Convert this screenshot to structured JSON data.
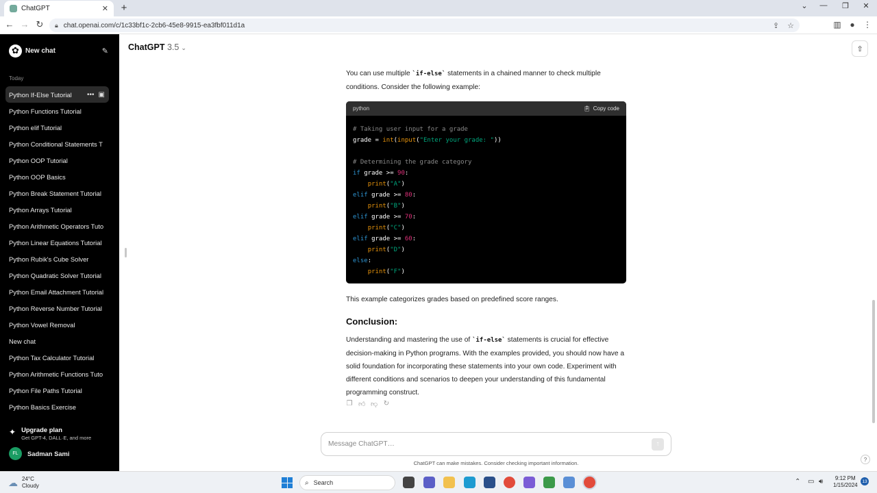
{
  "browser": {
    "tab_title": "ChatGPT",
    "tab_close": "✕",
    "new_tab": "+",
    "url": "chat.openai.com/c/1c33bf1c-2cb6-45e8-9915-ea3fbf011d1a"
  },
  "sidebar": {
    "new_chat_label": "New chat",
    "section_label": "Today",
    "items": [
      {
        "label": "Python If-Else Tutorial"
      },
      {
        "label": "Python Functions Tutorial"
      },
      {
        "label": "Python elif Tutorial"
      },
      {
        "label": "Python Conditional Statements T"
      },
      {
        "label": "Python OOP Tutorial"
      },
      {
        "label": "Python OOP Basics"
      },
      {
        "label": "Python Break Statement Tutorial"
      },
      {
        "label": "Python Arrays Tutorial"
      },
      {
        "label": "Python Arithmetic Operators Tuto"
      },
      {
        "label": "Python Linear Equations Tutorial"
      },
      {
        "label": "Python Rubik's Cube Solver"
      },
      {
        "label": "Python Quadratic Solver Tutorial"
      },
      {
        "label": "Python Email Attachment Tutorial"
      },
      {
        "label": "Python Reverse Number Tutorial"
      },
      {
        "label": "Python Vowel Removal"
      },
      {
        "label": "New chat"
      },
      {
        "label": "Python Tax Calculator Tutorial"
      },
      {
        "label": "Python Arithmetic Functions Tuto"
      },
      {
        "label": "Python File Paths Tutorial"
      },
      {
        "label": "Python Basics Exercise"
      }
    ],
    "upgrade_title": "Upgrade plan",
    "upgrade_subtitle": "Get GPT-4, DALL·E, and more",
    "user_initials": "FL",
    "user_name": "Sadman Sami"
  },
  "header": {
    "model_name": "ChatGPT",
    "model_version": "3.5"
  },
  "message": {
    "intro_before": "You can use multiple ",
    "intro_code": "`if-else`",
    "intro_after": " statements in a chained manner to check multiple conditions. Consider the following example:",
    "code_lang": "python",
    "copy_label": "Copy code",
    "code_lines": [
      [
        [
          "c-com",
          "# Taking user input for a grade"
        ]
      ],
      [
        [
          "",
          "grade = "
        ],
        [
          "c-fn",
          "int"
        ],
        [
          "",
          "("
        ],
        [
          "c-fn",
          "input"
        ],
        [
          "",
          "("
        ],
        [
          "c-str",
          "\"Enter your grade: \""
        ],
        [
          "",
          "))"
        ]
      ],
      [
        [
          "",
          ""
        ]
      ],
      [
        [
          "c-com",
          "# Determining the grade category"
        ]
      ],
      [
        [
          "c-kw",
          "if"
        ],
        [
          "",
          " grade >= "
        ],
        [
          "c-num",
          "90"
        ],
        [
          "",
          ":"
        ]
      ],
      [
        [
          "",
          "    "
        ],
        [
          "c-fn",
          "print"
        ],
        [
          "",
          "("
        ],
        [
          "c-str",
          "\"A\""
        ],
        [
          "",
          ")"
        ]
      ],
      [
        [
          "c-kw",
          "elif"
        ],
        [
          "",
          " grade >= "
        ],
        [
          "c-num",
          "80"
        ],
        [
          "",
          ":"
        ]
      ],
      [
        [
          "",
          "    "
        ],
        [
          "c-fn",
          "print"
        ],
        [
          "",
          "("
        ],
        [
          "c-str",
          "\"B\""
        ],
        [
          "",
          ")"
        ]
      ],
      [
        [
          "c-kw",
          "elif"
        ],
        [
          "",
          " grade >= "
        ],
        [
          "c-num",
          "70"
        ],
        [
          "",
          ":"
        ]
      ],
      [
        [
          "",
          "    "
        ],
        [
          "c-fn",
          "print"
        ],
        [
          "",
          "("
        ],
        [
          "c-str",
          "\"C\""
        ],
        [
          "",
          ")"
        ]
      ],
      [
        [
          "c-kw",
          "elif"
        ],
        [
          "",
          " grade >= "
        ],
        [
          "c-num",
          "60"
        ],
        [
          "",
          ":"
        ]
      ],
      [
        [
          "",
          "    "
        ],
        [
          "c-fn",
          "print"
        ],
        [
          "",
          "("
        ],
        [
          "c-str",
          "\"D\""
        ],
        [
          "",
          ")"
        ]
      ],
      [
        [
          "c-kw",
          "else"
        ],
        [
          "",
          ":"
        ]
      ],
      [
        [
          "",
          "    "
        ],
        [
          "c-fn",
          "print"
        ],
        [
          "",
          "("
        ],
        [
          "c-str",
          "\"F\""
        ],
        [
          "",
          ")"
        ]
      ]
    ],
    "after_code": "This example categorizes grades based on predefined score ranges.",
    "conclusion_heading": "Conclusion:",
    "conclusion_before": "Understanding and mastering the use of ",
    "conclusion_code": "`if-else`",
    "conclusion_after": " statements is crucial for effective decision-making in Python programs. With the examples provided, you should now have a solid foundation for incorporating these statements into your own code. Experiment with different conditions and scenarios to deepen your understanding of this fundamental programming construct."
  },
  "composer": {
    "placeholder": "Message ChatGPT…",
    "disclaimer": "ChatGPT can make mistakes. Consider checking important information.",
    "help": "?"
  },
  "taskbar": {
    "temperature": "24°C",
    "condition": "Cloudy",
    "search_label": "Search",
    "time": "9:12 PM",
    "date": "1/15/2024",
    "notification_count": "13"
  },
  "colors": {
    "sidebar_bg": "#000000",
    "code_keyword": "#2e95d3",
    "code_function": "#e9950c",
    "code_number": "#df3079",
    "code_string": "#00a67d"
  }
}
